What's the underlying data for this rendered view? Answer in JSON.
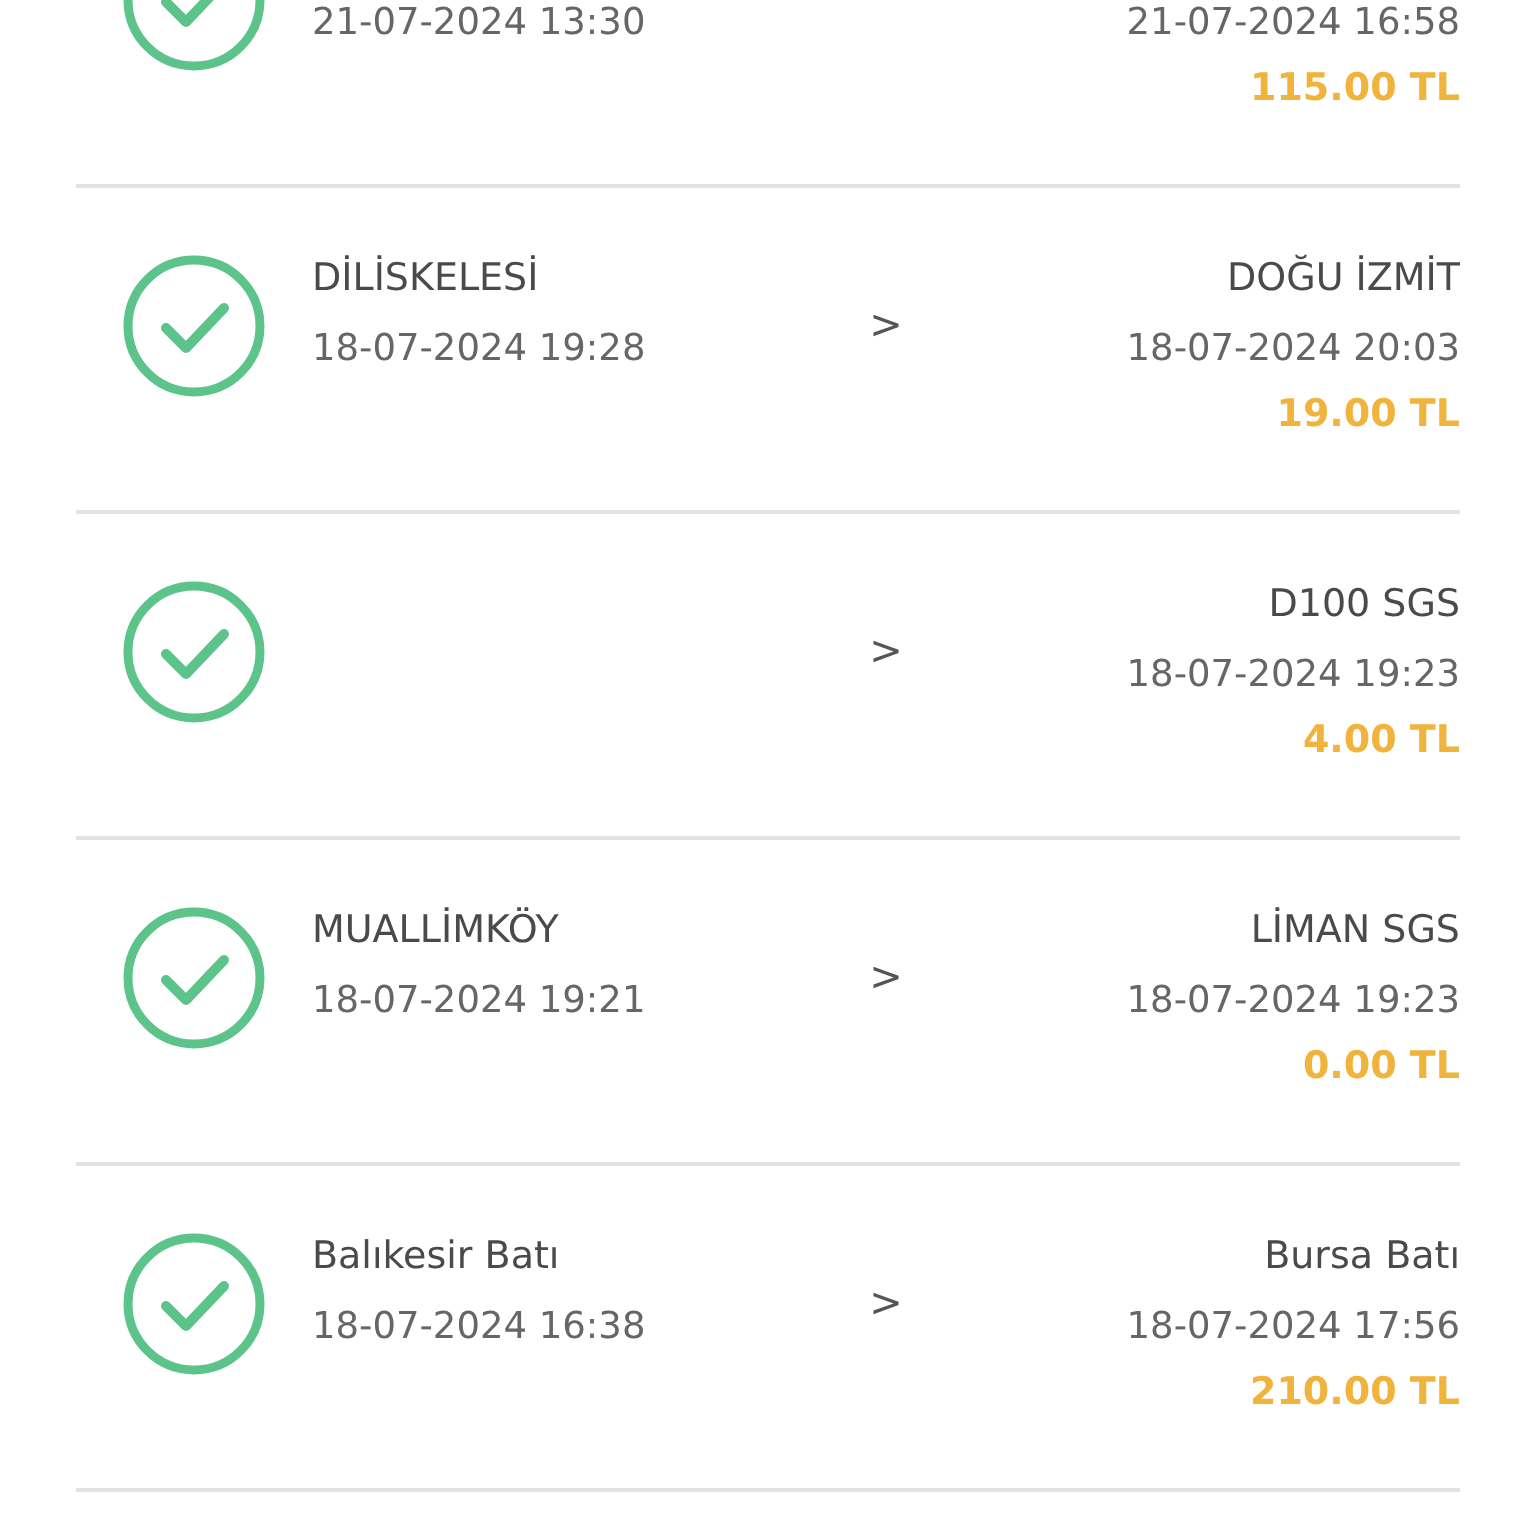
{
  "passages": [
    {
      "completed": true,
      "entry_time": "21-07-2024 13:30",
      "exit_time": "21-07-2024 16:58",
      "amount": "115.00 TL"
    },
    {
      "completed": true,
      "entry": "DİLİSKELESİ",
      "arrow": ">",
      "entry_time": "18-07-2024 19:28",
      "exit": "DOĞU İZMİT",
      "exit_time": "18-07-2024 20:03",
      "amount": "19.00 TL"
    },
    {
      "completed": true,
      "arrow": ">",
      "exit": "D100 SGS",
      "exit_time": "18-07-2024 19:23",
      "amount": "4.00 TL"
    },
    {
      "completed": true,
      "entry": "MUALLİMKÖY",
      "arrow": ">",
      "entry_time": "18-07-2024 19:21",
      "exit": "LİMAN SGS",
      "exit_time": "18-07-2024 19:23",
      "amount": "0.00 TL"
    },
    {
      "completed": true,
      "entry": "Balıkesir Batı",
      "arrow": ">",
      "entry_time": "18-07-2024 16:38",
      "exit": "Bursa Batı",
      "exit_time": "18-07-2024 17:56",
      "amount": "210.00 TL"
    }
  ]
}
